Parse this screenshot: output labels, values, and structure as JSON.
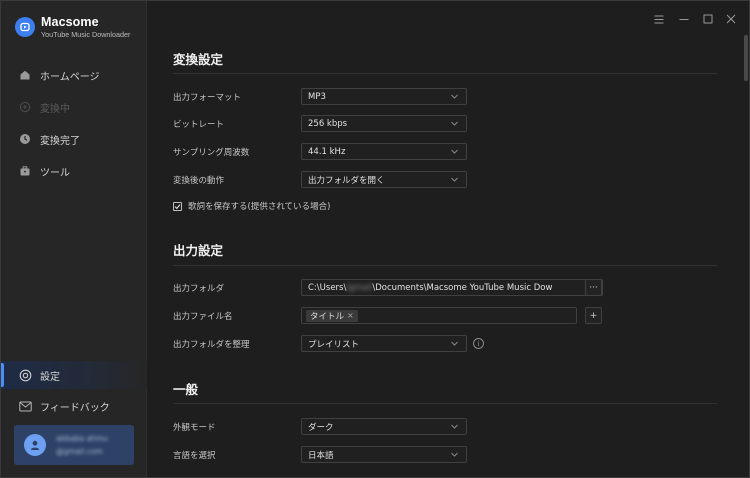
{
  "app": {
    "name": "Macsome",
    "subtitle": "YouTube Music Downloader"
  },
  "sidebar": {
    "items": [
      {
        "label": "ホームページ",
        "icon": "home-icon"
      },
      {
        "label": "変換中",
        "icon": "converting-icon",
        "disabled": true
      },
      {
        "label": "変換完了",
        "icon": "clock-icon"
      },
      {
        "label": "ツール",
        "icon": "toolbox-icon"
      }
    ],
    "bottom": [
      {
        "label": "設定",
        "icon": "gear-icon",
        "active": true
      },
      {
        "label": "フィードバック",
        "icon": "mail-icon"
      }
    ],
    "user": {
      "name_blurred": "abbaba ahmu",
      "email_blurred": "@gmail.com"
    }
  },
  "window_controls": {
    "menu": "menu-icon",
    "minimize": "minimize-icon",
    "maximize": "maximize-icon",
    "close": "close-icon"
  },
  "convert_settings": {
    "title": "変換設定",
    "format": {
      "label": "出力フォーマット",
      "value": "MP3"
    },
    "bitrate": {
      "label": "ビットレート",
      "value": "256 kbps"
    },
    "samplerate": {
      "label": "サンプリング周波数",
      "value": "44.1 kHz"
    },
    "after": {
      "label": "変換後の動作",
      "value": "出力フォルダを開く"
    },
    "lyrics": {
      "label": "歌詞を保存する(提供されている場合)",
      "checked": true
    }
  },
  "output_settings": {
    "title": "出力設定",
    "folder": {
      "label": "出力フォルダ",
      "prefix": "C:\\Users\\",
      "blurred": "lgmail",
      "suffix": "\\Documents\\Macsome YouTube Music Dow",
      "browse": "···"
    },
    "filename": {
      "label": "出力ファイル名",
      "tag": "タイトル",
      "tag_remove": "×",
      "add": "+"
    },
    "organize": {
      "label": "出力フォルダを整理",
      "value": "プレイリスト",
      "info": "i"
    }
  },
  "general": {
    "title": "一般",
    "appearance": {
      "label": "外観モード",
      "value": "ダーク"
    },
    "language": {
      "label": "言語を選択",
      "value": "日本語"
    }
  },
  "colors": {
    "accent": "#4c8df6",
    "sidebar_bg": "#262626",
    "content_bg": "#1e1e1e",
    "user_card_bg": "#2d4266"
  }
}
